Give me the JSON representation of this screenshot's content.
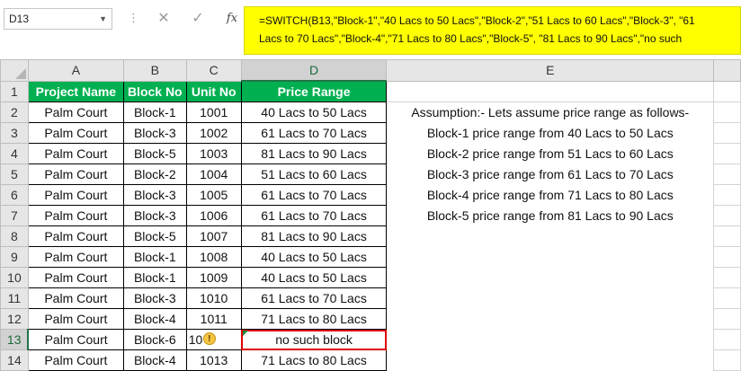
{
  "formula_bar": {
    "name_box": "D13",
    "cancel_icon": "✕",
    "enter_icon": "✓",
    "fx_label": "fx",
    "formula_line1": "=SWITCH(B13,\"Block-1\",\"40 Lacs to 50 Lacs\",\"Block-2\",\"51 Lacs to 60 Lacs\",\"Block-3\", \"61",
    "formula_line2": "Lacs to 70 Lacs\",\"Block-4\",\"71 Lacs to 80 Lacs\",\"Block-5\", \"81 Lacs to 90 Lacs\",\"no such"
  },
  "columns": [
    "A",
    "B",
    "C",
    "D",
    "E"
  ],
  "selected_column": "D",
  "selected_row": "13",
  "header_row": {
    "row_num": "1",
    "project": "Project Name",
    "block": "Block No",
    "unit": "Unit No",
    "price": "Price Range"
  },
  "rows": [
    {
      "num": "2",
      "project": "Palm Court",
      "block": "Block-1",
      "unit": "1001",
      "price": "40 Lacs to 50 Lacs",
      "note": "Assumption:- Lets assume price range as follows-"
    },
    {
      "num": "3",
      "project": "Palm Court",
      "block": "Block-3",
      "unit": "1002",
      "price": "61 Lacs to 70 Lacs",
      "note": "Block-1 price range from 40 Lacs to 50 Lacs"
    },
    {
      "num": "4",
      "project": "Palm Court",
      "block": "Block-5",
      "unit": "1003",
      "price": "81 Lacs to 90 Lacs",
      "note": "Block-2 price range from 51 Lacs to 60 Lacs"
    },
    {
      "num": "5",
      "project": "Palm Court",
      "block": "Block-2",
      "unit": "1004",
      "price": "51 Lacs to 60 Lacs",
      "note": "Block-3 price range from 61 Lacs to 70 Lacs"
    },
    {
      "num": "6",
      "project": "Palm Court",
      "block": "Block-3",
      "unit": "1005",
      "price": "61 Lacs to 70 Lacs",
      "note": "Block-4 price range from 71 Lacs to 80 Lacs"
    },
    {
      "num": "7",
      "project": "Palm Court",
      "block": "Block-3",
      "unit": "1006",
      "price": "61 Lacs to 70 Lacs",
      "note": "Block-5 price range from 81 Lacs to 90 Lacs"
    },
    {
      "num": "8",
      "project": "Palm Court",
      "block": "Block-5",
      "unit": "1007",
      "price": "81 Lacs to 90 Lacs",
      "note": ""
    },
    {
      "num": "9",
      "project": "Palm Court",
      "block": "Block-1",
      "unit": "1008",
      "price": "40 Lacs to 50 Lacs",
      "note": ""
    },
    {
      "num": "10",
      "project": "Palm Court",
      "block": "Block-1",
      "unit": "1009",
      "price": "40 Lacs to 50 Lacs",
      "note": ""
    },
    {
      "num": "11",
      "project": "Palm Court",
      "block": "Block-3",
      "unit": "1010",
      "price": "61 Lacs to 70 Lacs",
      "note": ""
    },
    {
      "num": "12",
      "project": "Palm Court",
      "block": "Block-4",
      "unit": "1011",
      "price": "71 Lacs to 80 Lacs",
      "note": ""
    },
    {
      "num": "13",
      "project": "Palm Court",
      "block": "Block-6",
      "unit": "10",
      "price": "no such block",
      "note": ""
    },
    {
      "num": "14",
      "project": "Palm Court",
      "block": "Block-4",
      "unit": "1013",
      "price": "71 Lacs to 80 Lacs",
      "note": ""
    }
  ],
  "warning_icon_glyph": "!",
  "colors": {
    "header_fill": "#00b050",
    "formula_highlight": "#ffff00",
    "active_cell_border": "#e00000"
  }
}
